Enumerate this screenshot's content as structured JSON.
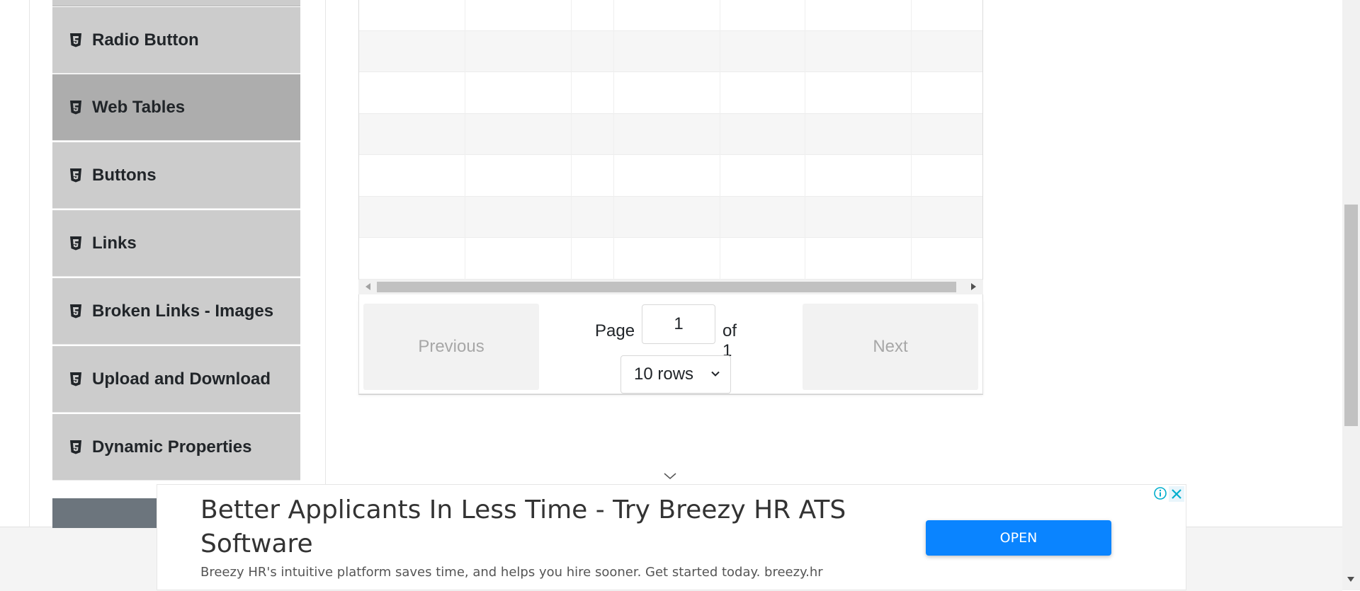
{
  "sidebar": {
    "items": [
      {
        "label": "Radio Button",
        "icon": "html5-icon",
        "active": false
      },
      {
        "label": "Web Tables",
        "icon": "html5-icon",
        "active": true
      },
      {
        "label": "Buttons",
        "icon": "html5-icon",
        "active": false
      },
      {
        "label": "Links",
        "icon": "html5-icon",
        "active": false
      },
      {
        "label": "Broken Links - Images",
        "icon": "html5-icon",
        "active": false
      },
      {
        "label": "Upload and Download",
        "icon": "html5-icon",
        "active": false
      },
      {
        "label": "Dynamic Properties",
        "icon": "html5-icon",
        "active": false
      }
    ]
  },
  "table": {
    "visible_empty_rows": 7
  },
  "pagination": {
    "previous_label": "Previous",
    "next_label": "Next",
    "page_label": "Page",
    "page_value": "1",
    "of_label": "of 1",
    "rows_selected": "10 rows"
  },
  "ad": {
    "title": "Better Applicants In Less Time - Try Breezy HR ATS Software",
    "description": "Breezy HR's intuitive platform saves time, and helps you hire sooner. Get started today. breezy.hr",
    "open_label": "OPEN",
    "info_icon": "info-icon",
    "close_icon": "close-icon"
  },
  "colors": {
    "sidebar_bg": "#cccccc",
    "sidebar_active_bg": "#adadad",
    "ad_button": "#0a84ff"
  }
}
